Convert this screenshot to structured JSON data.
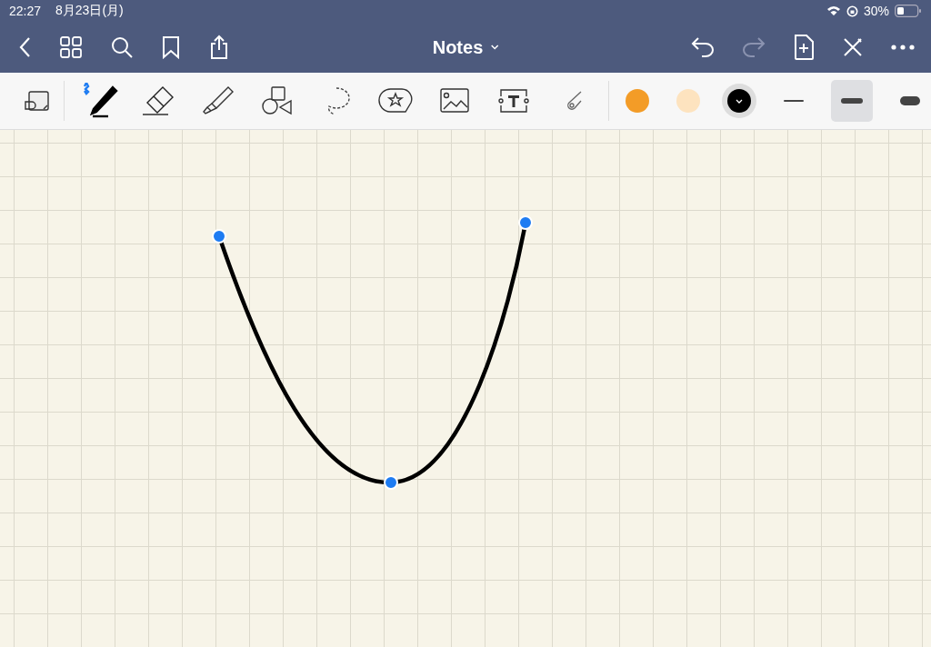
{
  "status_bar": {
    "time": "22:27",
    "date": "8月23日(月)",
    "battery": "30%"
  },
  "nav": {
    "title": "Notes"
  },
  "tools": [
    {
      "kind": "layout",
      "selected": false
    },
    {
      "kind": "pen",
      "selected": true
    },
    {
      "kind": "eraser",
      "selected": false
    },
    {
      "kind": "highlighter",
      "selected": false
    },
    {
      "kind": "shapes",
      "selected": false
    },
    {
      "kind": "lasso",
      "selected": false
    },
    {
      "kind": "sticker",
      "selected": false
    },
    {
      "kind": "image",
      "selected": false
    },
    {
      "kind": "text",
      "selected": false
    },
    {
      "kind": "laser",
      "selected": false
    }
  ],
  "colors": [
    {
      "color": "#f39c27",
      "selected": false
    },
    {
      "color": "#fde3bf",
      "selected": false
    },
    {
      "color": "#000000",
      "selected": true
    }
  ],
  "widths": [
    {
      "kind": "thin",
      "selected": false
    },
    {
      "kind": "medium",
      "selected": true
    },
    {
      "kind": "thick",
      "selected": false
    }
  ]
}
